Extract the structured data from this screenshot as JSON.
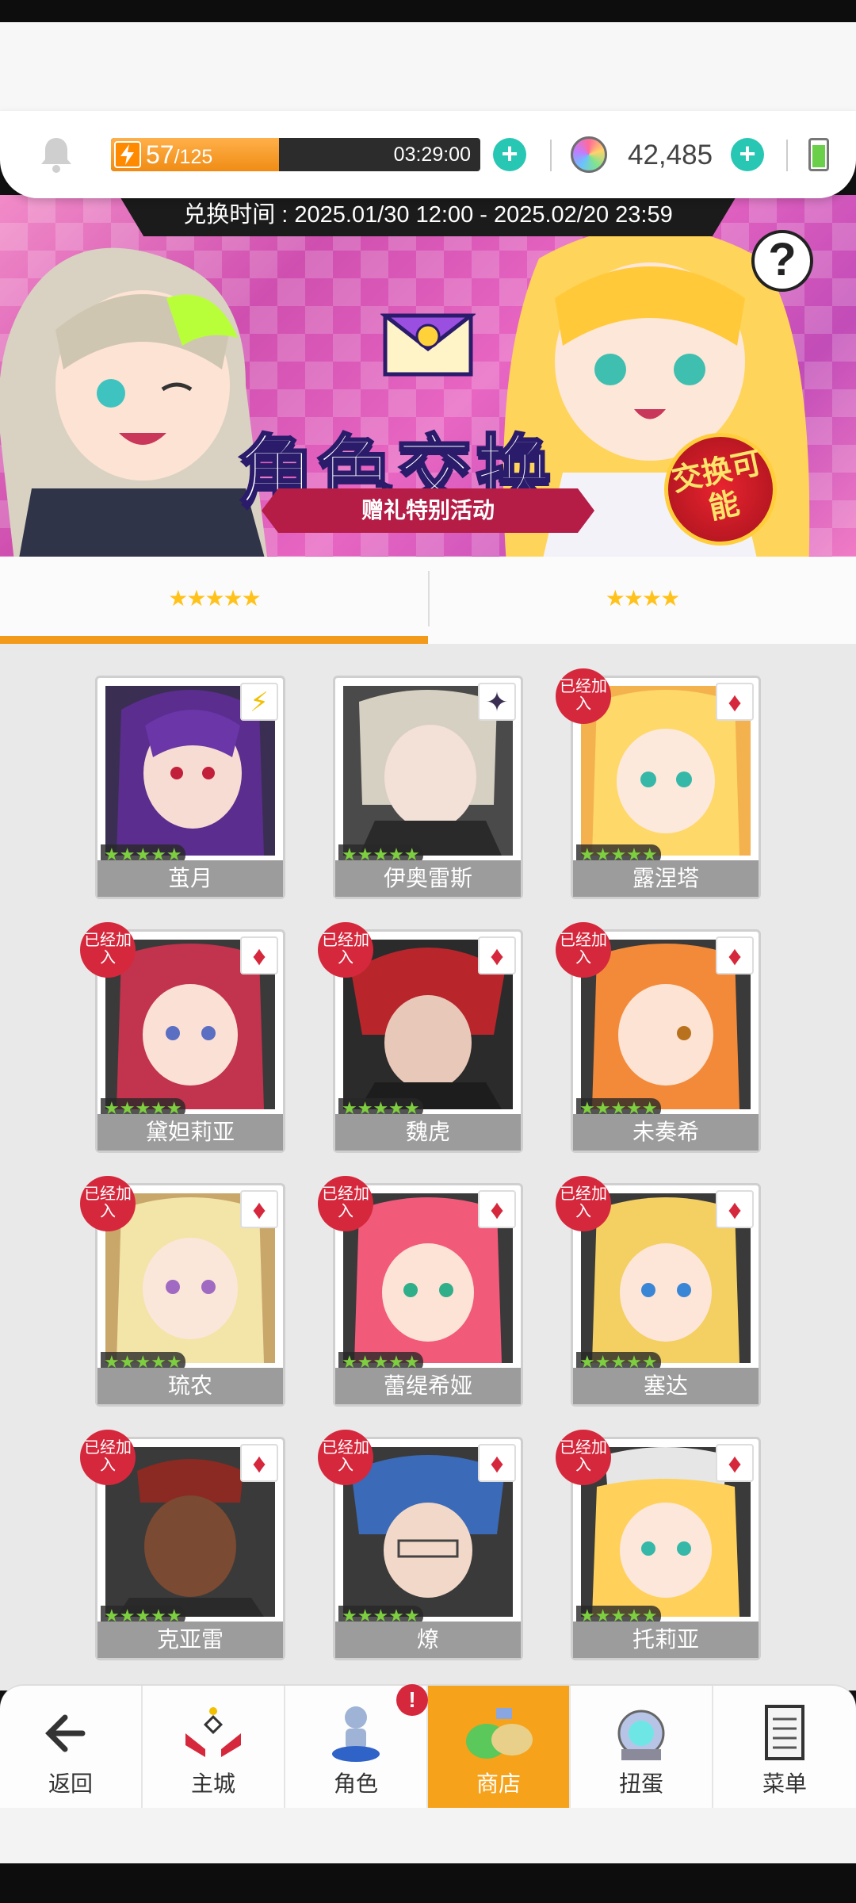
{
  "hud": {
    "stamina_current": "57",
    "stamina_max": "/125",
    "stamina_fraction": 0.456,
    "timer": "03:29:00",
    "gems": "42,485"
  },
  "banner": {
    "exchange_time": "兑换时间 : 2025.01/30 12:00 - 2025.02/20 23:59",
    "title": "角色交换",
    "subtitle": "赠礼特别活动",
    "badge": "交换可能",
    "help": "?"
  },
  "tabs": [
    {
      "label": "★★★★★",
      "active": true
    },
    {
      "label": "★★★★",
      "active": false
    }
  ],
  "cards": [
    {
      "name": "茧月",
      "rarity": "★★★★★",
      "element": "⚡",
      "joined": false,
      "joined_label": ""
    },
    {
      "name": "伊奥雷斯",
      "rarity": "★★★★★",
      "element": "✦",
      "joined": false,
      "joined_label": ""
    },
    {
      "name": "露涅塔",
      "rarity": "★★★★★",
      "element": "♦",
      "joined": true,
      "joined_label": "已经加入"
    },
    {
      "name": "黛妲莉亚",
      "rarity": "★★★★★",
      "element": "♦",
      "joined": true,
      "joined_label": "已经加入"
    },
    {
      "name": "魏虎",
      "rarity": "★★★★★",
      "element": "♦",
      "joined": true,
      "joined_label": "已经加入"
    },
    {
      "name": "未奏希",
      "rarity": "★★★★★",
      "element": "♦",
      "joined": true,
      "joined_label": "已经加入"
    },
    {
      "name": "琉农",
      "rarity": "★★★★★",
      "element": "♦",
      "joined": true,
      "joined_label": "已经加入"
    },
    {
      "name": "蕾缇希娅",
      "rarity": "★★★★★",
      "element": "♦",
      "joined": true,
      "joined_label": "已经加入"
    },
    {
      "name": "塞达",
      "rarity": "★★★★★",
      "element": "♦",
      "joined": true,
      "joined_label": "已经加入"
    },
    {
      "name": "克亚雷",
      "rarity": "★★★★★",
      "element": "♦",
      "joined": true,
      "joined_label": "已经加入"
    },
    {
      "name": "燎",
      "rarity": "★★★★★",
      "element": "♦",
      "joined": true,
      "joined_label": "已经加入"
    },
    {
      "name": "托莉亚",
      "rarity": "★★★★★",
      "element": "♦",
      "joined": true,
      "joined_label": "已经加入"
    }
  ],
  "nav": [
    {
      "label": "返回",
      "icon": "back-arrow-icon"
    },
    {
      "label": "主城",
      "icon": "castle-icon"
    },
    {
      "label": "角色",
      "icon": "character-icon",
      "alert": "!"
    },
    {
      "label": "商店",
      "icon": "shop-icon",
      "active": true
    },
    {
      "label": "扭蛋",
      "icon": "gacha-icon"
    },
    {
      "label": "菜单",
      "icon": "menu-list-icon"
    }
  ],
  "colors": {
    "accent": "#f7a21b",
    "teal": "#27c7b3",
    "badge_red": "#d6283c"
  }
}
